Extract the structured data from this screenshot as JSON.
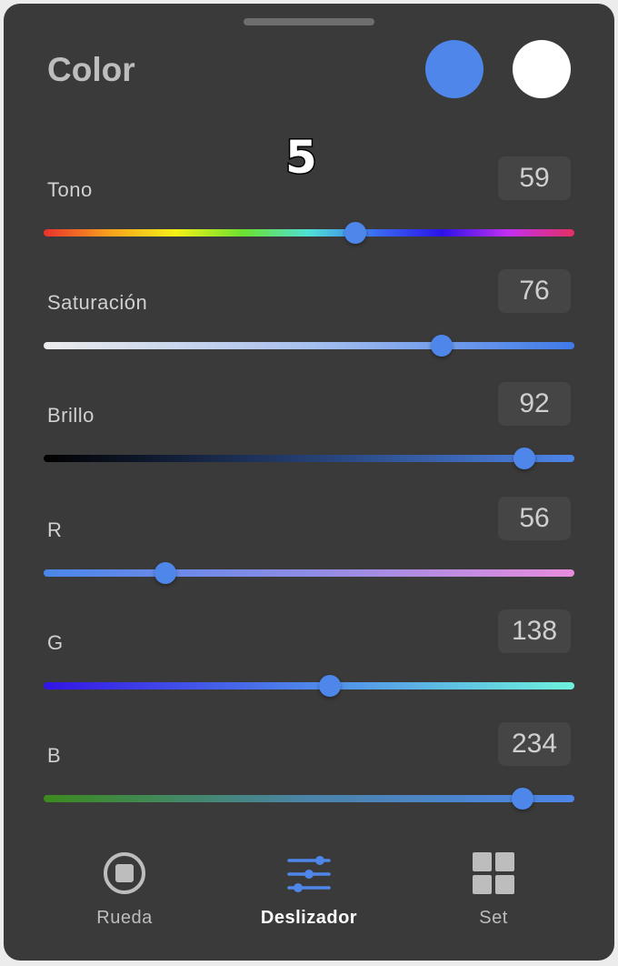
{
  "header": {
    "title": "Color",
    "primary_color": "#4e86ea",
    "secondary_color": "#ffffff",
    "badge": "5"
  },
  "sliders": [
    {
      "label": "Tono",
      "value": "59",
      "fraction": 0.588,
      "gradient": [
        "#e8312c",
        "#f7a21c",
        "#f4f017",
        "#6be12f",
        "#4fe0d6",
        "#3b6cf0",
        "#2a12e8",
        "#c32ff0",
        "#e33062"
      ]
    },
    {
      "label": "Saturación",
      "value": "76",
      "fraction": 0.75,
      "gradient": [
        "#ececec",
        "#a7c0ee",
        "#3e7ae8"
      ]
    },
    {
      "label": "Brillo",
      "value": "92",
      "fraction": 0.905,
      "gradient": [
        "#000000",
        "#253f72",
        "#4e86ea"
      ]
    },
    {
      "label": "R",
      "value": "56",
      "fraction": 0.23,
      "gradient": [
        "#4a87ea",
        "#8e8ce6",
        "#e88cdc"
      ]
    },
    {
      "label": "G",
      "value": "138",
      "fraction": 0.54,
      "gradient": [
        "#3314e6",
        "#4e86ea",
        "#6ef2dc"
      ]
    },
    {
      "label": "B",
      "value": "234",
      "fraction": 0.902,
      "gradient": [
        "#3c8a1e",
        "#4a84a8",
        "#4e86ea"
      ]
    }
  ],
  "tabs": [
    {
      "label": "Rueda",
      "icon": "wheel-icon",
      "active": false
    },
    {
      "label": "Deslizador",
      "icon": "sliders-icon",
      "active": true
    },
    {
      "label": "Set",
      "icon": "grid-icon",
      "active": false
    }
  ],
  "colors": {
    "accent": "#4e86ea",
    "panel": "#3a3a3a"
  }
}
